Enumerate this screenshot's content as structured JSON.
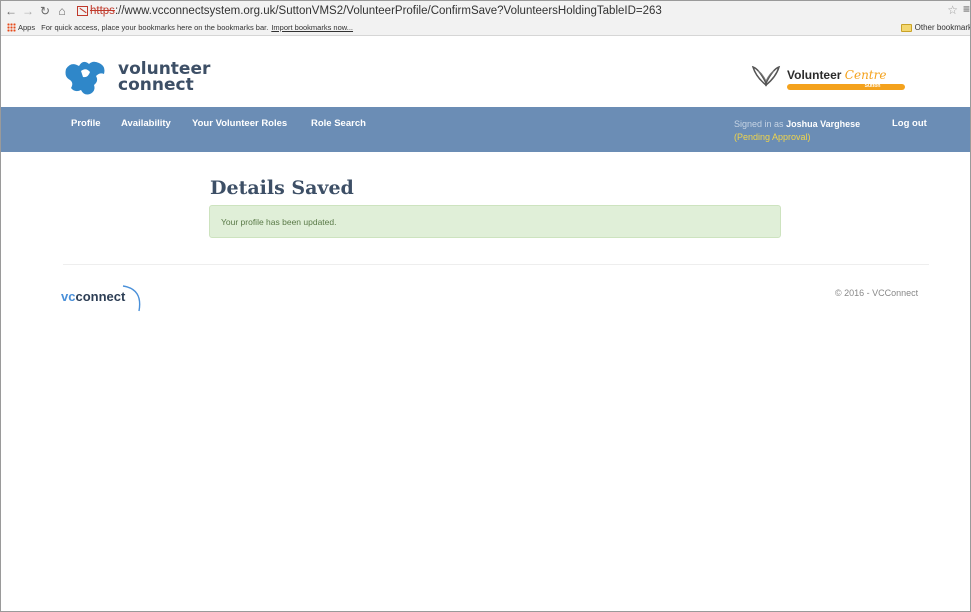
{
  "browser": {
    "url_protocol": "https",
    "url_rest": "://www.vcconnectsystem.org.uk/SuttonVMS2/VolunteerProfile/ConfirmSave?VolunteersHoldingTableID=263",
    "bookmarks_apps": "Apps",
    "bookmarks_hint": "For quick access, place your bookmarks here on the bookmarks bar.",
    "bookmarks_import": "Import bookmarks now...",
    "other_bookmarks": "Other bookmark"
  },
  "header": {
    "brand_line1": "volunteer",
    "brand_line2": "connect",
    "partner_word1": "Volunteer",
    "partner_word2": "Centre",
    "partner_sub": "Sutton"
  },
  "nav": {
    "items": [
      "Profile",
      "Availability",
      "Your Volunteer Roles",
      "Role Search"
    ],
    "signed_prefix": "Signed in as",
    "user_name": "Joshua Varghese",
    "status": "(Pending Approval)",
    "logout": "Log out"
  },
  "main": {
    "title": "Details Saved",
    "alert": "Your profile has been updated."
  },
  "footer": {
    "logo_v": "vc",
    "logo_rest": "connect",
    "copyright": "© 2016 - VCConnect"
  },
  "colors": {
    "nav_bg": "#6b8db5",
    "accent_orange": "#f4a21d",
    "success_bg": "#e0efd8",
    "title": "#3d4f66"
  }
}
